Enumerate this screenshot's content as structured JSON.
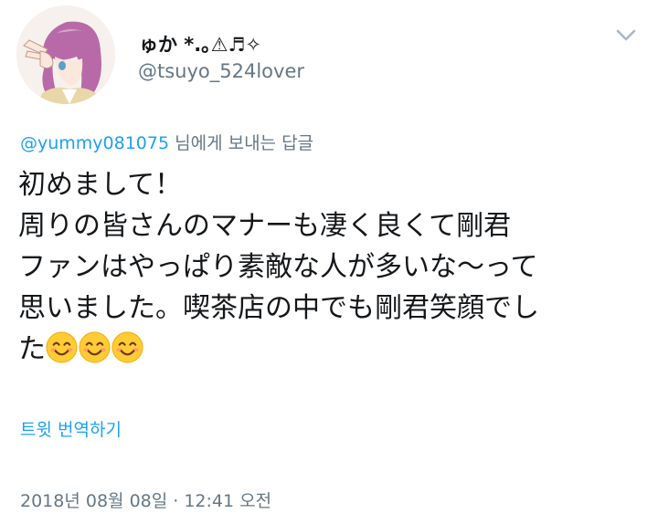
{
  "author": {
    "display_name": "ゅか *.｡⚠︎♬✧",
    "handle": "@tsuyo_524lover"
  },
  "reply": {
    "mention": "@yummy081075",
    "suffix": " 님에게 보내는 답글"
  },
  "tweet": {
    "lines": [
      "初めまして！",
      "周りの皆さんのマナーも凄く良くて剛君",
      "ファンはやっぱり素敵な人が多いな〜って",
      "思いました。喫茶店の中でも剛君笑顔でし",
      "た"
    ],
    "emoji": [
      "smiling-face-emoji",
      "smiling-face-emoji",
      "smiling-face-emoji"
    ]
  },
  "translate_label": "트윗 번역하기",
  "timestamp": "2018년 08월 08일 · 12:41 오전",
  "colors": {
    "link": "#1da1f2",
    "secondary_text": "#657786",
    "primary_text": "#14171a"
  }
}
